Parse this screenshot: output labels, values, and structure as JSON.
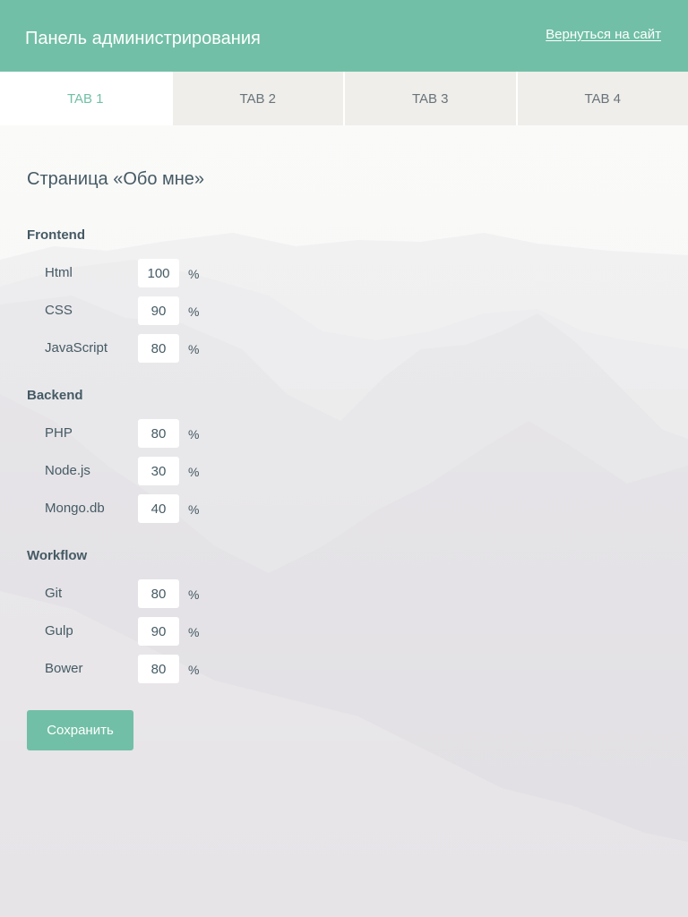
{
  "header": {
    "title": "Панель администрирования",
    "back_link": "Вернуться на сайт"
  },
  "tabs": [
    {
      "label": "TAB 1",
      "active": true
    },
    {
      "label": "TAB 2",
      "active": false
    },
    {
      "label": "TAB 3",
      "active": false
    },
    {
      "label": "TAB 4",
      "active": false
    }
  ],
  "page": {
    "title": "Страница «Обо мне»",
    "groups": [
      {
        "title": "Frontend",
        "skills": [
          {
            "name": "Html",
            "value": "100"
          },
          {
            "name": "CSS",
            "value": "90"
          },
          {
            "name": "JavaScript",
            "value": "80"
          }
        ]
      },
      {
        "title": "Backend",
        "skills": [
          {
            "name": "PHP",
            "value": "80"
          },
          {
            "name": "Node.js",
            "value": "30"
          },
          {
            "name": "Mongo.db",
            "value": "40"
          }
        ]
      },
      {
        "title": "Workflow",
        "skills": [
          {
            "name": "Git",
            "value": "80"
          },
          {
            "name": "Gulp",
            "value": "90"
          },
          {
            "name": "Bower",
            "value": "80"
          }
        ]
      }
    ],
    "unit": "%",
    "save_label": "Сохранить"
  },
  "colors": {
    "accent": "#71bfa6",
    "text": "#455a64",
    "tab_inactive_bg": "#efeeea"
  }
}
